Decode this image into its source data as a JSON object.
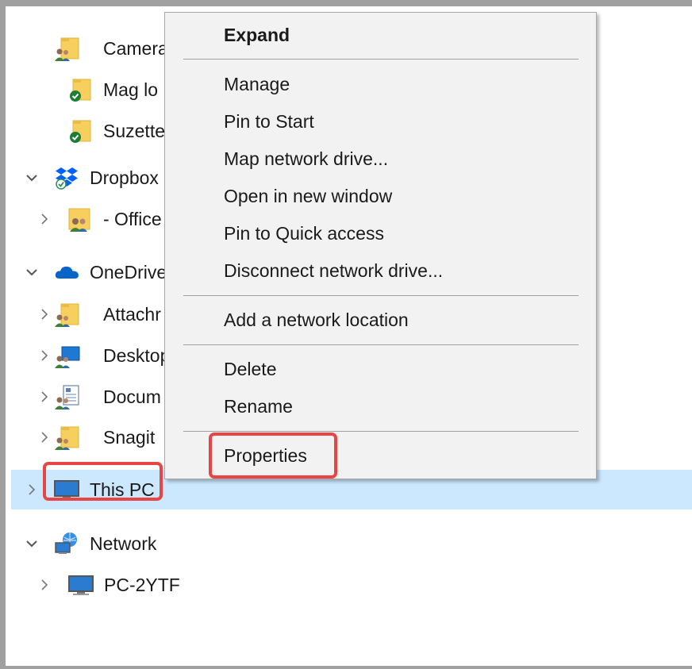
{
  "navigation_pane": {
    "items": [
      {
        "label": "Camera",
        "icon": "shared-folder-icon"
      },
      {
        "label": "Mag lo",
        "icon": "synced-folder-icon"
      },
      {
        "label": "Suzette",
        "icon": "synced-folder-icon"
      },
      {
        "label": "Dropbox",
        "icon": "dropbox-icon",
        "expanded": true
      },
      {
        "label": "- Office",
        "icon": "shared-folder-icon",
        "expanded": false
      },
      {
        "label": "OneDrive",
        "icon": "onedrive-icon",
        "expanded": true
      },
      {
        "label": "Attachr",
        "icon": "shared-folder-icon",
        "expanded": false
      },
      {
        "label": "Desktop",
        "icon": "shared-desktop-icon",
        "expanded": false
      },
      {
        "label": "Docum",
        "icon": "shared-documents-icon",
        "expanded": false
      },
      {
        "label": "Snagit",
        "icon": "shared-folder-icon",
        "expanded": false
      },
      {
        "label": "This PC",
        "icon": "computer-icon",
        "expanded": false,
        "selected": true
      },
      {
        "label": "Network",
        "icon": "network-icon",
        "expanded": true
      },
      {
        "label": "PC-2YTF",
        "icon": "computer-icon",
        "expanded": false
      }
    ]
  },
  "context_menu": {
    "expand": "Expand",
    "manage": "Manage",
    "pin_to_start": "Pin to Start",
    "map_network_drive": "Map network drive...",
    "open_in_new_window": "Open in new window",
    "pin_to_quick_access": "Pin to Quick access",
    "disconnect_network_drive": "Disconnect network drive...",
    "add_network_location": "Add a network location",
    "delete": "Delete",
    "rename": "Rename",
    "properties": "Properties"
  },
  "colors": {
    "highlight": "#e84545",
    "selection": "#cce8ff",
    "menu_background": "#f2f2f2",
    "frame": "#a0a0a0"
  }
}
